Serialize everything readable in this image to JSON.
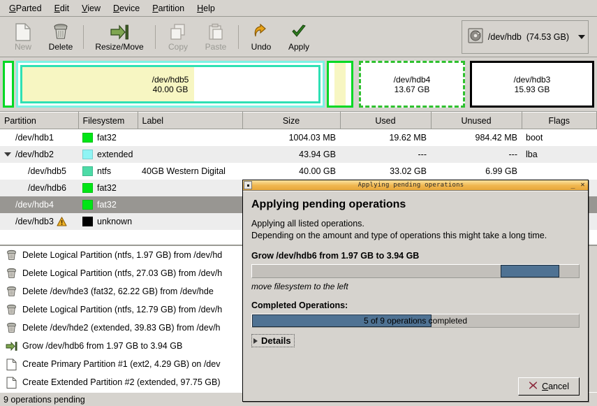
{
  "menu": {
    "items": [
      {
        "label": "GParted",
        "accel": "G"
      },
      {
        "label": "Edit",
        "accel": "E"
      },
      {
        "label": "View",
        "accel": "V"
      },
      {
        "label": "Device",
        "accel": "D"
      },
      {
        "label": "Partition",
        "accel": "P"
      },
      {
        "label": "Help",
        "accel": "H"
      }
    ]
  },
  "toolbar": {
    "new_label": "New",
    "delete_label": "Delete",
    "resize_label": "Resize/Move",
    "copy_label": "Copy",
    "paste_label": "Paste",
    "undo_label": "Undo",
    "apply_label": "Apply",
    "device_name": "/dev/hdb",
    "device_size": "(74.53 GB)"
  },
  "disk_graphic": {
    "partitions": [
      {
        "name": "",
        "size": "",
        "style": "unallocated-small"
      },
      {
        "name": "/dev/hdb5",
        "size": "40.00 GB",
        "style": "extended-logical"
      },
      {
        "name": "",
        "size": "",
        "style": "small-yellow"
      },
      {
        "name": "/dev/hdb4",
        "size": "13.67 GB",
        "style": "selected"
      },
      {
        "name": "/dev/hdb3",
        "size": "15.93 GB",
        "style": "plain"
      }
    ]
  },
  "table": {
    "headers": [
      "Partition",
      "Filesystem",
      "Label",
      "Size",
      "Used",
      "Unused",
      "Flags"
    ],
    "rows": [
      {
        "partition": "/dev/hdb1",
        "fs": "fat32",
        "color": "#00e516",
        "label": "",
        "size": "1004.03 MB",
        "used": "19.62 MB",
        "unused": "984.42 MB",
        "flags": "boot",
        "indent": 1,
        "twisty": false,
        "warn": false,
        "selected": false
      },
      {
        "partition": "/dev/hdb2",
        "fs": "extended",
        "color": "#8ff4f4",
        "label": "",
        "size": "43.94 GB",
        "used": "---",
        "unused": "---",
        "flags": "lba",
        "indent": 0,
        "twisty": true,
        "warn": false,
        "selected": false
      },
      {
        "partition": "/dev/hdb5",
        "fs": "ntfs",
        "color": "#4ddba7",
        "label": "40GB Western Digital",
        "size": "40.00 GB",
        "used": "33.02 GB",
        "unused": "6.99 GB",
        "flags": "",
        "indent": 2,
        "twisty": false,
        "warn": false,
        "selected": false
      },
      {
        "partition": "/dev/hdb6",
        "fs": "fat32",
        "color": "#00e516",
        "label": "",
        "size": "",
        "used": "",
        "unused": "",
        "flags": "",
        "indent": 2,
        "twisty": false,
        "warn": false,
        "selected": false
      },
      {
        "partition": "/dev/hdb4",
        "fs": "fat32",
        "color": "#00e516",
        "label": "",
        "size": "",
        "used": "",
        "unused": "",
        "flags": "",
        "indent": 1,
        "twisty": false,
        "warn": false,
        "selected": true
      },
      {
        "partition": "/dev/hdb3",
        "fs": "unknown",
        "color": "#000000",
        "label": "",
        "size": "",
        "used": "",
        "unused": "",
        "flags": "",
        "indent": 1,
        "twisty": false,
        "warn": true,
        "selected": false
      }
    ]
  },
  "operations": {
    "items": [
      {
        "icon": "delete-icon",
        "text": "Delete Logical Partition (ntfs, 1.97 GB) from /dev/hd"
      },
      {
        "icon": "delete-icon",
        "text": "Delete Logical Partition (ntfs, 27.03 GB) from /dev/h"
      },
      {
        "icon": "delete-icon",
        "text": "Delete /dev/hde3 (fat32, 62.22 GB) from /dev/hde"
      },
      {
        "icon": "delete-icon",
        "text": "Delete Logical Partition (ntfs, 12.79 GB) from /dev/h"
      },
      {
        "icon": "delete-icon",
        "text": "Delete /dev/hde2 (extended, 39.83 GB) from /dev/h"
      },
      {
        "icon": "resize-icon",
        "text": "Grow /dev/hdb6 from 1.97 GB to 3.94 GB"
      },
      {
        "icon": "create-icon",
        "text": "Create Primary Partition #1 (ext2, 4.29 GB) on /dev"
      },
      {
        "icon": "create-icon",
        "text": "Create Extended Partition #2 (extended, 97.75 GB)"
      }
    ]
  },
  "statusbar": {
    "text": "9 operations pending"
  },
  "dialog": {
    "titlebar_text": "Applying pending operations",
    "minimize_glyph": "_",
    "close_glyph": "✕",
    "heading": "Applying pending operations",
    "line1": "Applying all listed operations.",
    "line2": "Depending on the amount and type of operations this might take a long time.",
    "current_operation": "Grow /dev/hdb6 from 1.97 GB to 3.94 GB",
    "current_note": "move filesystem to the left",
    "completed_heading": "Completed Operations:",
    "completed_text": "5 of 9 operations completed",
    "completed_percent": 55,
    "details_label": "Details",
    "cancel_label": "Cancel",
    "cancel_accel": "C"
  },
  "colors": {
    "chrome": "#d6d3ce",
    "title_accent": "#f0b64e",
    "progress_fill": "#4f7293",
    "selection": "#989692",
    "fat32": "#00e516",
    "extended": "#8ff4f4",
    "ntfs": "#4ddba7",
    "unknown": "#000000"
  }
}
